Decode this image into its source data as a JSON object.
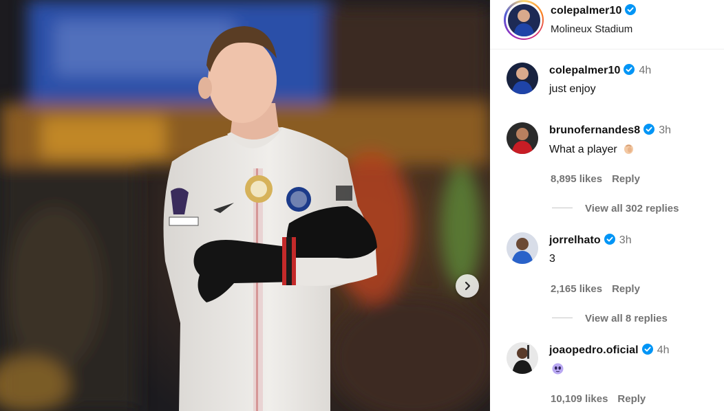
{
  "post": {
    "username": "colepalmer10",
    "location": "Molineux Stadium"
  },
  "comments": [
    {
      "username": "colepalmer10",
      "time": "4h",
      "text": "just enjoy"
    },
    {
      "username": "brunofernandes8",
      "time": "3h",
      "text": "What a player",
      "emoji": "clapping-hands",
      "likes": "8,895 likes",
      "reply": "Reply",
      "view_replies": "View all 302 replies"
    },
    {
      "username": "jorrelhato",
      "time": "3h",
      "text": "3",
      "likes": "2,165 likes",
      "reply": "Reply",
      "view_replies": "View all 8 replies"
    },
    {
      "username": "joaopedro.oficial",
      "time": "4h",
      "emoji": "purple-alien-face",
      "likes": "10,109 likes",
      "reply": "Reply"
    }
  ],
  "media": {
    "image": "football player in white kit with black gloves, arms crossed",
    "next_button_icon": "chevron-right-icon"
  },
  "colors": {
    "verified": "#0095f6",
    "secondary_text": "#737373"
  }
}
